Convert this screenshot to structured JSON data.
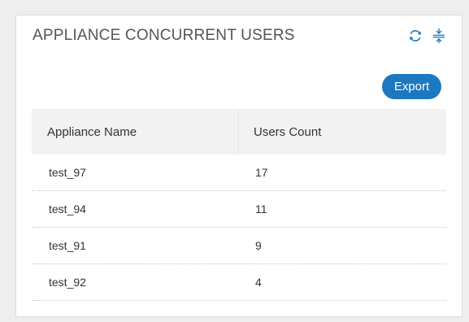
{
  "widget": {
    "title": "APPLIANCE CONCURRENT USERS",
    "icons": [
      "refresh-icon",
      "collapse-icon"
    ],
    "export_label": "Export",
    "accent_color": "#1c78c0"
  },
  "table": {
    "columns": [
      "Appliance Name",
      "Users Count"
    ],
    "rows": [
      {
        "name": "test_97",
        "count": "17"
      },
      {
        "name": "test_94",
        "count": "11"
      },
      {
        "name": "test_91",
        "count": "9"
      },
      {
        "name": "test_92",
        "count": "4"
      }
    ]
  }
}
